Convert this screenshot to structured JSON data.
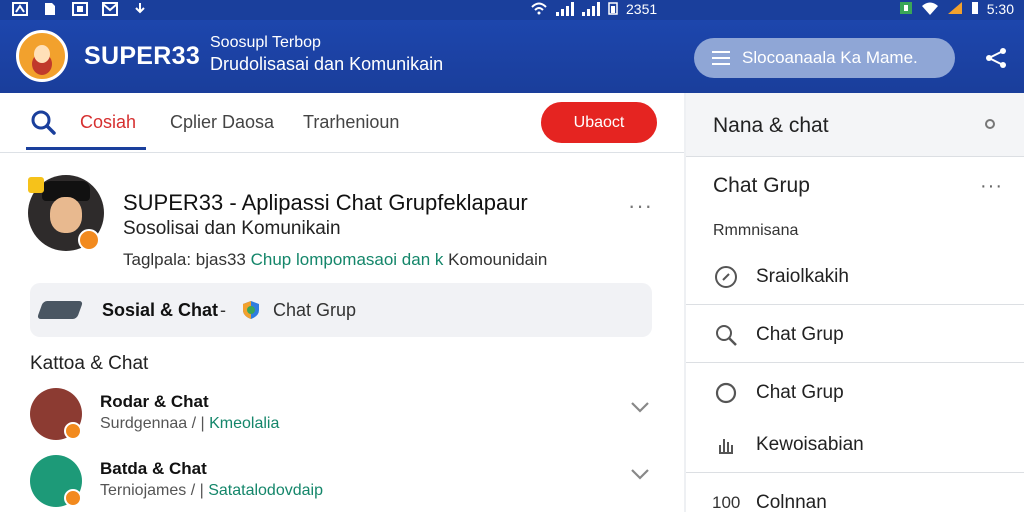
{
  "status_bar": {
    "time_center": "2351",
    "time_right": "5:30",
    "colors": {
      "background": "#1a3f9c"
    }
  },
  "app_bar": {
    "app_name": "SUPER33",
    "subtitle_line1": "Soosupl Terbop",
    "subtitle_line2": "Drudolisasai dan Komunikain",
    "menu_label": "Slocoanaala Ka Mame.",
    "icons": {
      "menu": "hamburger-icon",
      "share": "share-icon"
    },
    "colors": {
      "background": "#1d46ad",
      "pill": "#8fa6d6"
    }
  },
  "tabs": {
    "items": [
      {
        "label": "Cosiah",
        "active": true
      },
      {
        "label": "Cplier Daosa",
        "active": false
      },
      {
        "label": "Trarhenioun",
        "active": false
      }
    ],
    "cta_label": "Ubaoct",
    "colors": {
      "active": "#d62f2f",
      "cta": "#e52421",
      "underline": "#1a3f9c"
    }
  },
  "post": {
    "title": "SUPER33 - Aplipassi Chat Grupfeklapaur",
    "subtitle": "Sosolisai dan Komunikain",
    "tagline_label": "Taglpala: ",
    "tagline_mid": "bjas33",
    "tagline_hl": " Chup lompomasaoi dan k ",
    "tagline_end": "Komounidain",
    "more": "···"
  },
  "category_chip": {
    "main": "Sosial & Chat",
    "separator": "-",
    "secondary": "Chat Grup",
    "icons": {
      "device": "phone-icon",
      "shield": "shield-icon"
    }
  },
  "section": {
    "title": "Kattoa & Chat"
  },
  "list": [
    {
      "title": "Rodar & Chat",
      "sub_plain": "Surdgennaa / | ",
      "sub_highlight": "Kmeolalia",
      "avatar_color": "#8c3b32"
    },
    {
      "title": "Batda & Chat",
      "sub_plain": "Terniojames / | ",
      "sub_highlight": "Satatalodovdaip",
      "avatar_color": "#1d9a78"
    }
  ],
  "right_panel": {
    "header": "Nana & chat",
    "section_title": "Chat Grup",
    "section_more": "···",
    "caption": "Rmmnisana",
    "items": [
      {
        "label": "Sraiolkakih",
        "icon": "compass-icon"
      },
      {
        "label": "Chat Grup",
        "icon": "search-icon"
      },
      {
        "label": "Chat Grup",
        "icon": "chat-bubble-icon"
      },
      {
        "label": "Kewoisabian",
        "icon": "hand-icon"
      }
    ],
    "footer_count": "100",
    "footer_label": "Colnnan"
  }
}
